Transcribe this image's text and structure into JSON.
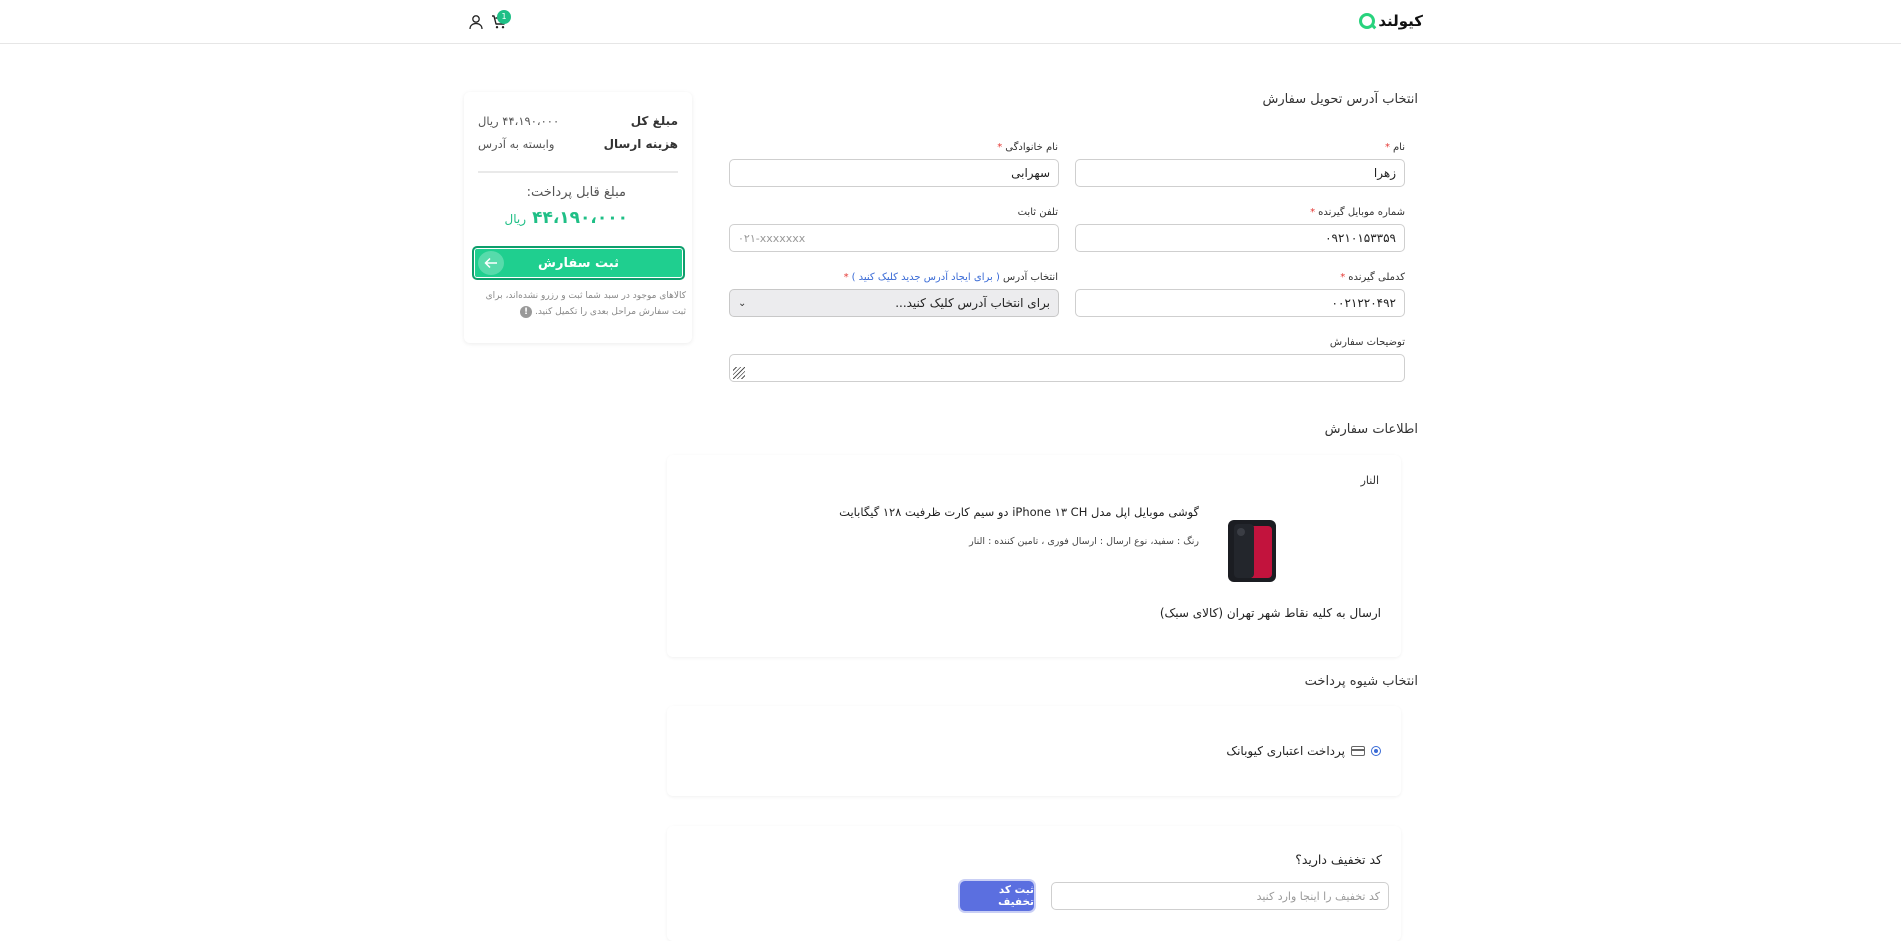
{
  "header": {
    "logo_text": "کیولند",
    "cart_count": "1",
    "icons": [
      "cart-icon",
      "user-icon"
    ]
  },
  "summary": {
    "total_label": "مبلغ کل",
    "total_value": "۴۴،۱۹۰،۰۰۰ ریال",
    "shipping_label": "هزینه ارسال",
    "shipping_value": "وابسته به آدرس",
    "payable_label": "مبلغ قابل پرداخت:",
    "payable_value": "۴۴،۱۹۰،۰۰۰",
    "payable_unit": "ریال",
    "submit_label": "ثبت سفارش",
    "note": "کالاهای موجود در سبد شما ثبت و رزرو نشده‌اند، برای ثبت سفارش مراحل بعدی را تکمیل کنید."
  },
  "address": {
    "title": "انتخاب آدرس تحویل سفارش",
    "first_name_label": "نام",
    "first_name_value": "زهرا",
    "last_name_label": "نام خانوادگی",
    "last_name_value": "سهرابی",
    "mobile_label": "شماره موبایل گیرنده",
    "mobile_value": "۰۹۲۱۰۱۵۳۳۵۹",
    "phone_label": "تلفن ثابت",
    "phone_placeholder": "۰۲۱-xxxxxxx",
    "national_code_label": "کدملی گیرنده",
    "national_code_value": "۰۰۲۱۲۲۰۴۹۲",
    "address_select_label": "انتخاب آدرس",
    "address_select_link": "( برای ایجاد آدرس جدید کلیک کنید )",
    "address_select_value": "برای انتخاب آدرس کلیک کنید...",
    "notes_label": "توضیحات سفارش"
  },
  "order_info": {
    "title": "اطلاعات سفارش",
    "vendor": "النار",
    "product_title": "گوشی موبایل اپل مدل iPhone ۱۳ CH دو سیم کارت ظرفیت ۱۲۸ گیگابایت",
    "product_meta": "رنگ : سفید، نوع ارسال : ارسال فوری ، تامین کننده : النار",
    "shipping_note": "ارسال به کلیه نقاط شهر تهران (کالای سبک)"
  },
  "payment": {
    "title": "انتخاب شیوه پرداخت",
    "option_label": "پرداخت اعتباری کیوبانک",
    "selected": true
  },
  "discount": {
    "title": "کد تخفیف دارید؟",
    "placeholder": "کد تخفیف را اینجا وارد کنید",
    "button_label": "ثبت کد تخفیف"
  },
  "colors": {
    "accent_green": "#1fcf8f",
    "discount_button": "#5b6fe0",
    "link_blue": "#3a6bd6",
    "required_red": "#e53935"
  }
}
